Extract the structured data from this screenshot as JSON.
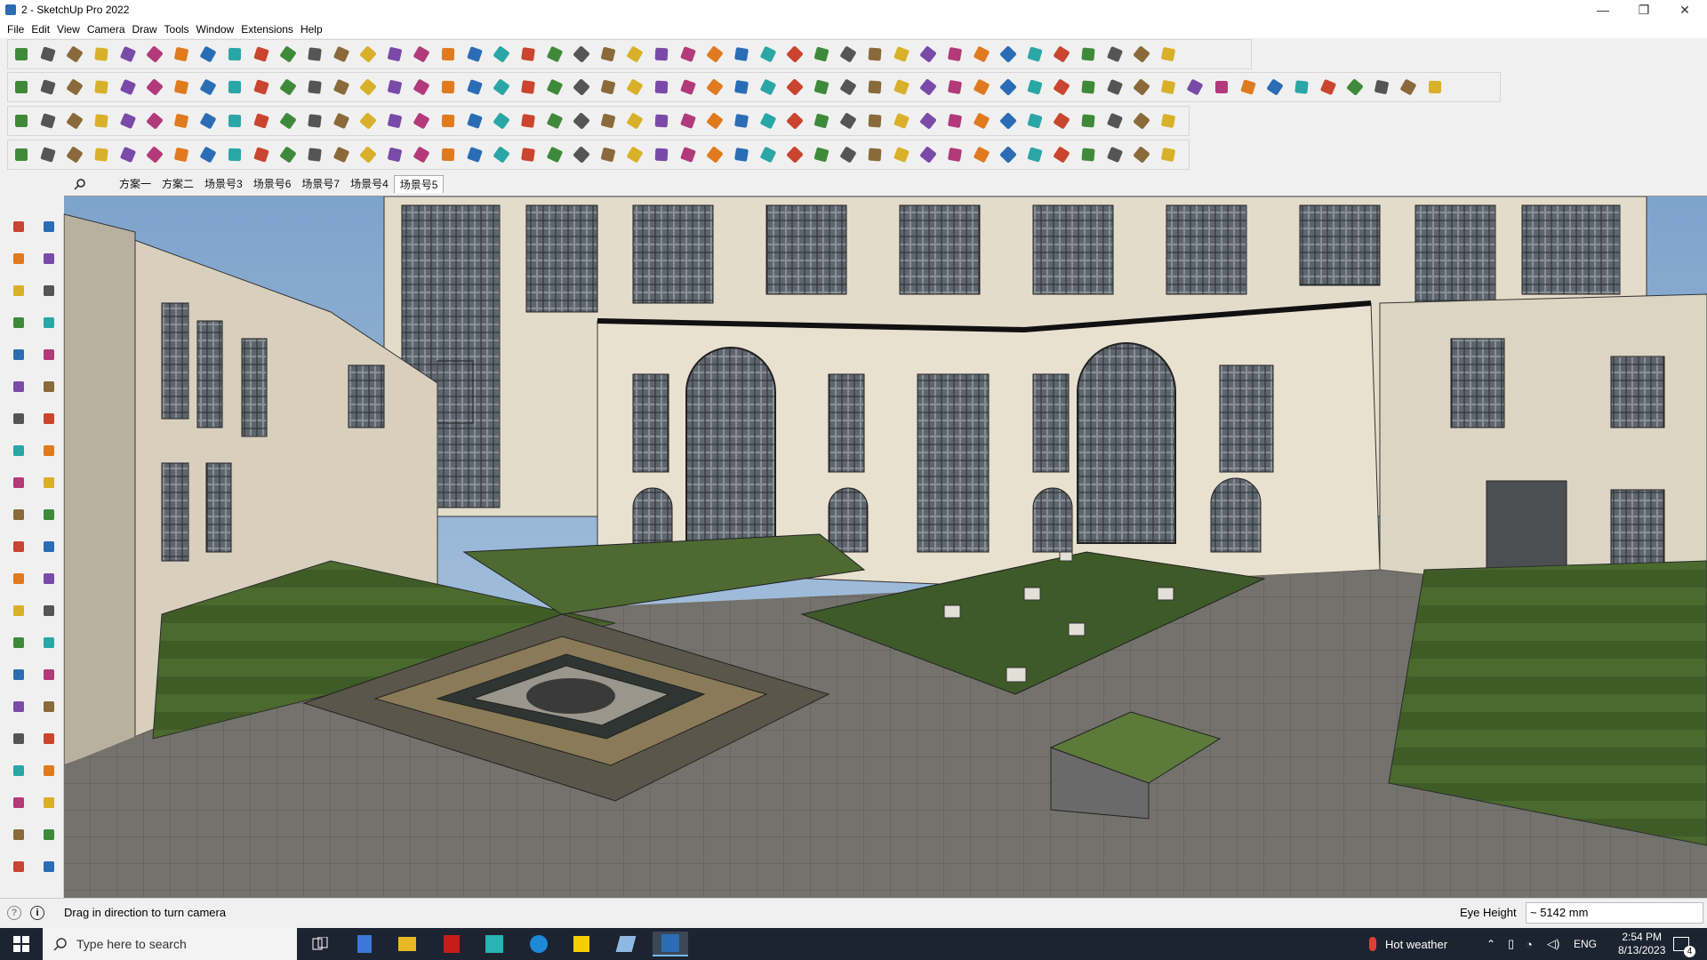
{
  "window": {
    "title": "2 - SketchUp Pro 2022",
    "minimize": "—",
    "restore": "❐",
    "close": "✕"
  },
  "menu": [
    "File",
    "Edit",
    "View",
    "Camera",
    "Draw",
    "Tools",
    "Window",
    "Extensions",
    "Help"
  ],
  "scenes": {
    "tabs": [
      "方案一",
      "方案二",
      "场景号3",
      "场景号6",
      "场景号7",
      "场景号4",
      "场景号5"
    ],
    "active_index": 6
  },
  "status": {
    "hint": "Drag in direction to turn camera",
    "measurement_label": "Eye Height",
    "measurement_value": "~ 5142 mm"
  },
  "taskbar": {
    "search_placeholder": "Type here to search",
    "weather": "Hot weather",
    "language": "ENG",
    "time": "2:54 PM",
    "date": "8/13/2023",
    "notification_count": "4"
  },
  "colors": {
    "sky": "#8fb2d6",
    "facade": "#e6ddca",
    "grass": "#3d5a26",
    "paving": "#6f6d68",
    "accent_blue": "#2a6db5"
  }
}
